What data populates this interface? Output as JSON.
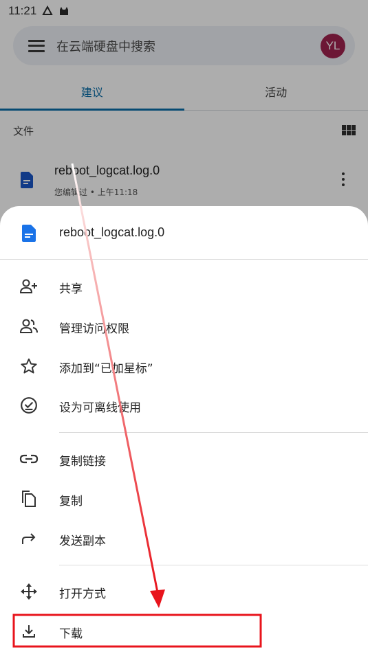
{
  "status_bar": {
    "time": "11:21"
  },
  "search": {
    "placeholder": "在云端硬盘中搜索",
    "avatar_initials": "YL"
  },
  "tabs": [
    {
      "label": "建议",
      "active": true
    },
    {
      "label": "活动",
      "active": false
    }
  ],
  "files_section": {
    "title": "文件"
  },
  "file": {
    "name": "reboot_logcat.log.0",
    "subtitle": "您编辑过 • 上午11:18"
  },
  "sheet": {
    "title": "reboot_logcat.log.0",
    "items": [
      {
        "label": "共享",
        "icon": "person-add-icon"
      },
      {
        "label": "管理访问权限",
        "icon": "people-icon"
      },
      {
        "label": "添加到“已加星标”",
        "icon": "star-icon"
      },
      {
        "label": "设为可离线使用",
        "icon": "offline-icon"
      },
      {
        "label": "复制链接",
        "icon": "link-icon"
      },
      {
        "label": "复制",
        "icon": "copy-icon"
      },
      {
        "label": "发送副本",
        "icon": "share-arrow-icon"
      },
      {
        "label": "打开方式",
        "icon": "open-with-icon"
      },
      {
        "label": "下载",
        "icon": "download-icon"
      }
    ]
  },
  "colors": {
    "accent": "#0a6ea8",
    "avatar": "#a0224e",
    "doc_icon": "#1a73e8",
    "annotation": "#e8141c"
  }
}
